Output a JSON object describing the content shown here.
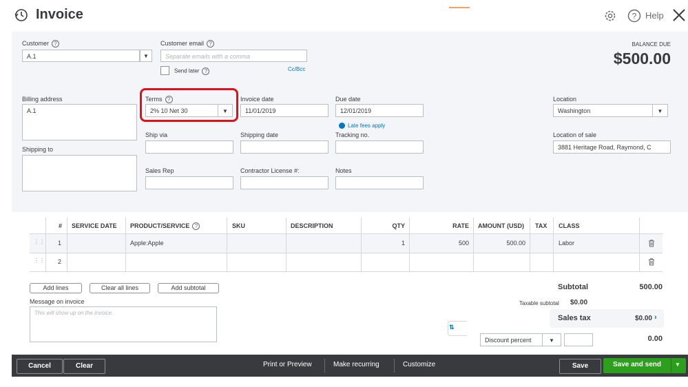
{
  "header": {
    "title": "Invoice",
    "help_label": "Help"
  },
  "customer": {
    "label": "Customer",
    "value": "A.1",
    "email_label": "Customer email",
    "email_placeholder": "Separate emails with a comma",
    "send_later_label": "Send later",
    "cc_bcc": "Cc/Bcc"
  },
  "balance": {
    "label": "BALANCE DUE",
    "amount": "$500.00"
  },
  "billing": {
    "label": "Billing address",
    "value": "A.1",
    "shipping_label": "Shipping to"
  },
  "terms": {
    "label": "Terms",
    "value": "2% 10 Net 30"
  },
  "invoice_date": {
    "label": "Invoice date",
    "value": "11/01/2019"
  },
  "due_date": {
    "label": "Due date",
    "value": "12/01/2019",
    "late_fees": "Late fees apply"
  },
  "location": {
    "label": "Location",
    "value": "Washington",
    "sale_label": "Location of sale",
    "sale_value": "3881  Heritage Road, Raymond, C"
  },
  "ship_via": {
    "label": "Ship via"
  },
  "shipping_date": {
    "label": "Shipping date"
  },
  "tracking": {
    "label": "Tracking no."
  },
  "sales_rep": {
    "label": "Sales Rep"
  },
  "contractor": {
    "label": "Contractor License #:"
  },
  "notes": {
    "label": "Notes"
  },
  "table": {
    "headers": [
      "#",
      "SERVICE DATE",
      "PRODUCT/SERVICE",
      "SKU",
      "DESCRIPTION",
      "QTY",
      "RATE",
      "AMOUNT (USD)",
      "TAX",
      "CLASS"
    ],
    "rows": [
      {
        "num": "1",
        "product": "Apple:Apple",
        "qty": "1",
        "rate": "500",
        "amount": "500.00",
        "class": "Labor"
      },
      {
        "num": "2",
        "product": "",
        "qty": "",
        "rate": "",
        "amount": "",
        "class": ""
      }
    ]
  },
  "actions": {
    "add_lines": "Add lines",
    "clear_all": "Clear all lines",
    "add_subtotal": "Add subtotal"
  },
  "message": {
    "label": "Message on invoice",
    "placeholder": "This will show up on the invoice."
  },
  "totals": {
    "subtotal_label": "Subtotal",
    "subtotal_value": "500.00",
    "taxable_label": "Taxable subtotal",
    "taxable_value": "$0.00",
    "sales_tax_label": "Sales tax",
    "sales_tax_value": "$0.00",
    "discount_label": "Discount percent",
    "discount_value": "0.00"
  },
  "footer": {
    "cancel": "Cancel",
    "clear": "Clear",
    "print": "Print or Preview",
    "recurring": "Make recurring",
    "customize": "Customize",
    "save": "Save",
    "save_send": "Save and send"
  },
  "colors": {
    "accent_green": "#2ca01c",
    "footer_bg": "#393a3d",
    "highlight": "#e0101a",
    "link": "#0077c5"
  }
}
